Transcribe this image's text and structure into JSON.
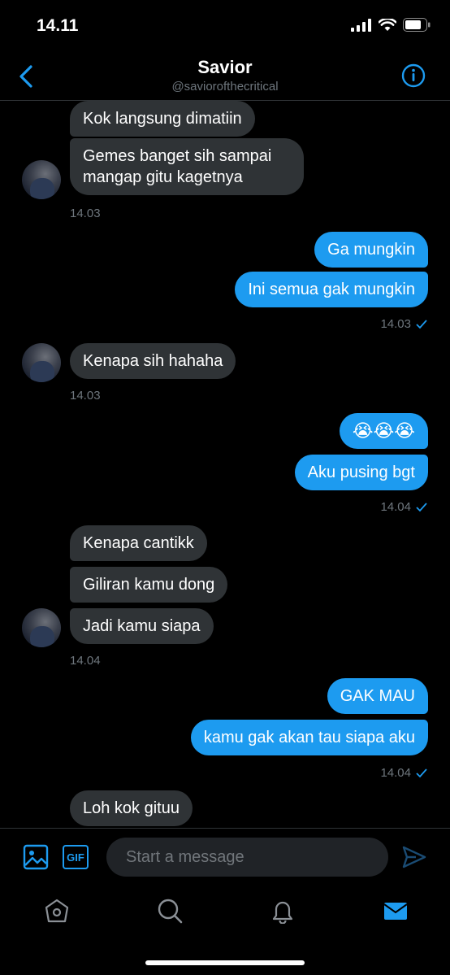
{
  "status": {
    "time": "14.11"
  },
  "header": {
    "title": "Savior",
    "handle": "@saviorofthecritical"
  },
  "messages": [
    {
      "id": "m1",
      "dir": "in",
      "text": "Kok langsung dimatiin"
    },
    {
      "id": "m2",
      "dir": "in",
      "text": "Gemes banget sih sampai mangap gitu kagetnya"
    },
    {
      "id": "t1",
      "dir": "in",
      "time": "14.03"
    },
    {
      "id": "m3",
      "dir": "out",
      "text": "Ga mungkin"
    },
    {
      "id": "m4",
      "dir": "out",
      "text": "Ini semua gak mungkin"
    },
    {
      "id": "t2",
      "dir": "out",
      "time": "14.03"
    },
    {
      "id": "m5",
      "dir": "in",
      "text": "Kenapa sih hahaha"
    },
    {
      "id": "t3",
      "dir": "in",
      "time": "14.03"
    },
    {
      "id": "m6",
      "dir": "out",
      "text": "😭😭😭"
    },
    {
      "id": "m7",
      "dir": "out",
      "text": "Aku pusing bgt"
    },
    {
      "id": "t4",
      "dir": "out",
      "time": "14.04"
    },
    {
      "id": "m8",
      "dir": "in",
      "text": "Kenapa cantikk"
    },
    {
      "id": "m9",
      "dir": "in",
      "text": "Giliran kamu dong"
    },
    {
      "id": "m10",
      "dir": "in",
      "text": "Jadi kamu siapa"
    },
    {
      "id": "t5",
      "dir": "in",
      "time": "14.04"
    },
    {
      "id": "m11",
      "dir": "out",
      "text": "GAK MAU"
    },
    {
      "id": "m12",
      "dir": "out",
      "text": "kamu gak akan tau siapa aku"
    },
    {
      "id": "t6",
      "dir": "out",
      "time": "14.04"
    },
    {
      "id": "m13",
      "dir": "in",
      "text": "Loh kok gituu"
    }
  ],
  "compose": {
    "placeholder": "Start a message",
    "gif_label": "GIF"
  },
  "icons": {
    "back": "chevron-left-icon",
    "info": "info-icon",
    "image": "image-icon",
    "gif": "gif-icon",
    "send": "send-icon",
    "home": "home-icon",
    "search": "search-icon",
    "notifications": "bell-icon",
    "messages": "mail-icon"
  },
  "colors": {
    "accent": "#1d9bf0",
    "incoming_bubble": "#2f3336",
    "background": "#000000"
  }
}
